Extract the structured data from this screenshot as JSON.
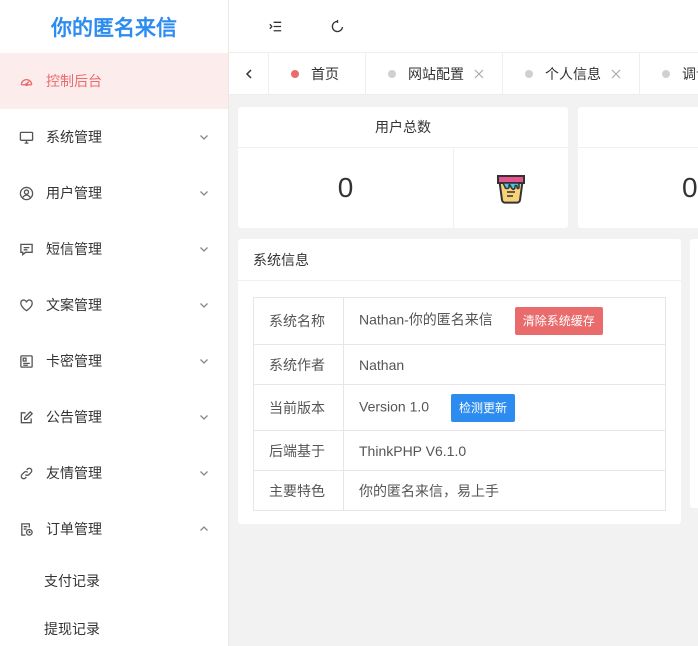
{
  "app": {
    "title": "你的匿名来信"
  },
  "sidebar": {
    "items": [
      {
        "label": "控制后台",
        "icon": "dashboard-icon",
        "active": true
      },
      {
        "label": "系统管理",
        "icon": "monitor-icon"
      },
      {
        "label": "用户管理",
        "icon": "user-icon"
      },
      {
        "label": "短信管理",
        "icon": "message-icon"
      },
      {
        "label": "文案管理",
        "icon": "heart-icon"
      },
      {
        "label": "卡密管理",
        "icon": "card-icon"
      },
      {
        "label": "公告管理",
        "icon": "edit-icon"
      },
      {
        "label": "友情管理",
        "icon": "link-icon"
      },
      {
        "label": "订单管理",
        "icon": "order-icon",
        "expanded": true
      }
    ],
    "subitems": [
      {
        "label": "支付记录"
      },
      {
        "label": "提现记录"
      }
    ]
  },
  "header": {
    "menu_toggle_icon": "indent-icon",
    "refresh_icon": "refresh-icon"
  },
  "tabs": [
    {
      "label": "首页",
      "active": true
    },
    {
      "label": "网站配置"
    },
    {
      "label": "个人信息"
    },
    {
      "label": "调试模"
    }
  ],
  "stats": {
    "users": {
      "title": "用户总数",
      "value": "0"
    },
    "second_value": "0"
  },
  "system_info": {
    "title": "系统信息",
    "rows": [
      {
        "key": "系统名称",
        "value": "Nathan-你的匿名来信",
        "button": "清除系统缓存"
      },
      {
        "key": "系统作者",
        "value": "Nathan"
      },
      {
        "key": "当前版本",
        "value": "Version 1.0",
        "button": "检测更新"
      },
      {
        "key": "后端基于",
        "value": "ThinkPHP V6.1.0"
      },
      {
        "key": "主要特色",
        "value": "你的匿名来信，易上手"
      }
    ]
  },
  "colors": {
    "accent": "#ea6b6b",
    "brand": "#2d8cf0",
    "active_bg": "#fdecec"
  }
}
